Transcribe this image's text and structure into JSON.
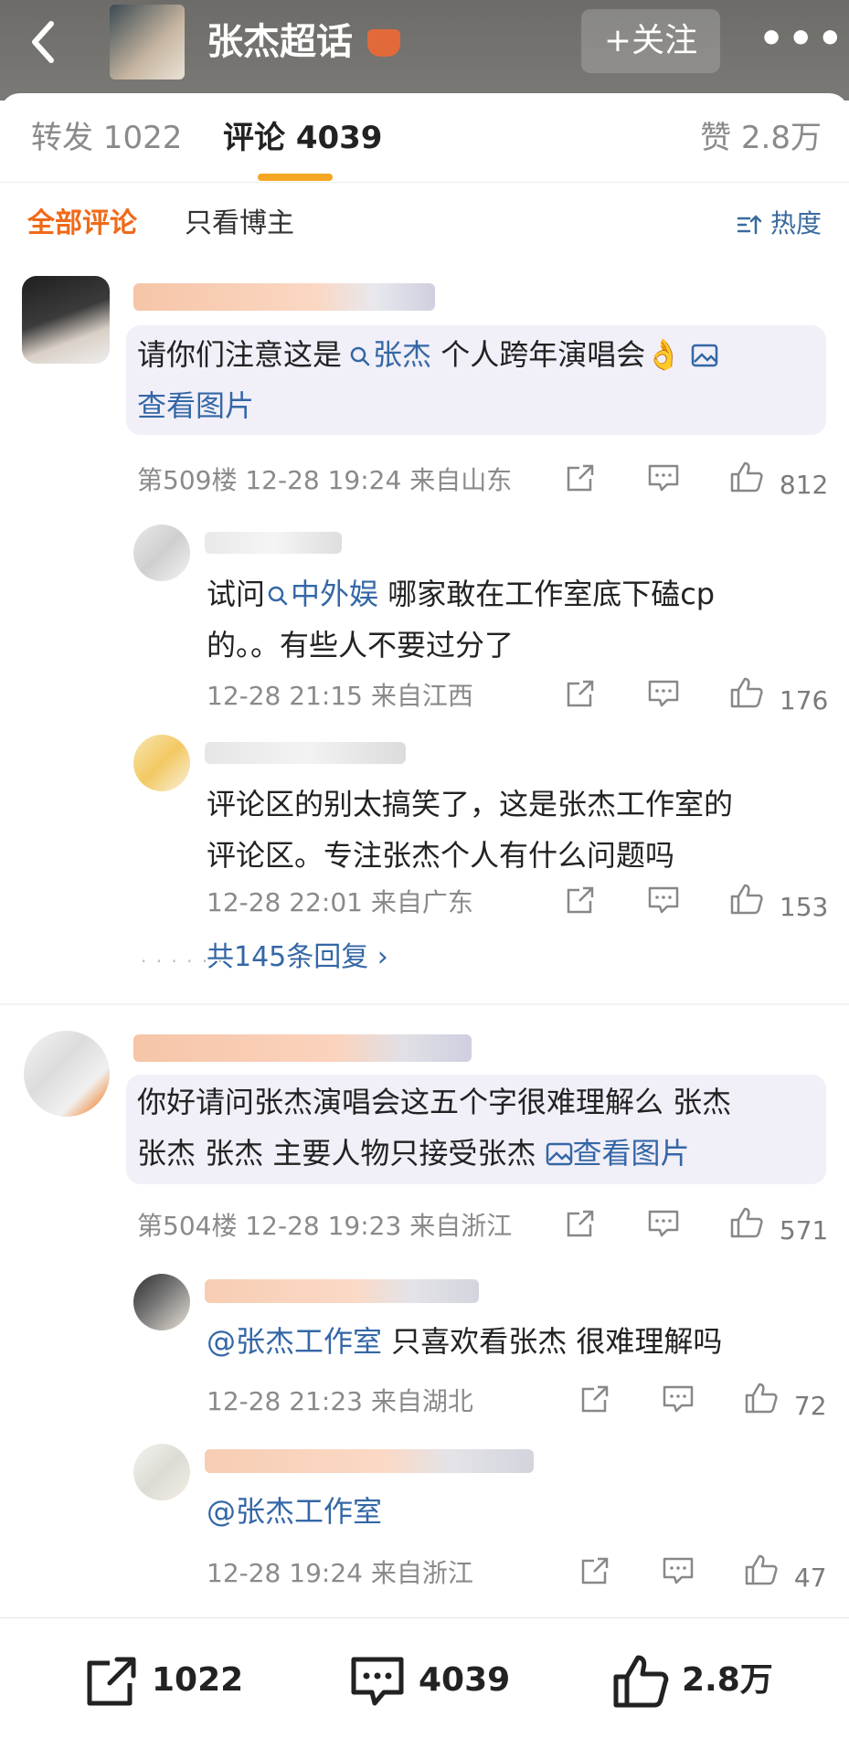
{
  "header": {
    "title": "张杰超话",
    "follow_label": "+关注",
    "more_label": "•••"
  },
  "tabs": [
    {
      "label": "转发 1022"
    },
    {
      "label": "评论 4039"
    },
    {
      "label": "赞 2.8万"
    }
  ],
  "filters": {
    "all": "全部评论",
    "owner_only": "只看博主",
    "sort": "热度"
  },
  "comments": [
    {
      "text_pre": "请你们注意这是",
      "mention": "张杰",
      "text_post": "个人跨年演唱会👌",
      "image_link": "查看图片",
      "floor": "第509楼",
      "time": "12-28 19:24",
      "location": "来自山东",
      "likes": "812",
      "replies": [
        {
          "text_pre": "试问",
          "mention": "中外娱",
          "text_post": "哪家敢在工作室底下磕cp",
          "text_line2": "的。。有些人不要过分了",
          "time": "12-28 21:15",
          "location": "来自江西",
          "likes": "176"
        },
        {
          "text_line1": "评论区的别太搞笑了，这是张杰工作室的",
          "text_line2": "评论区。专注张杰个人有什么问题吗",
          "time": "12-28 22:01",
          "location": "来自广东",
          "likes": "153"
        }
      ],
      "reply_count": "共145条回复 ›"
    },
    {
      "text_line1": "你好请问张杰演唱会这五个字很难理解么 张杰",
      "text_line2_pre": "张杰 张杰 主要人物只接受张杰",
      "image_link": "查看图片",
      "floor": "第504楼",
      "time": "12-28 19:23",
      "location": "来自浙江",
      "likes": "571",
      "replies": [
        {
          "mention": "@张杰工作室",
          "text_post": "只喜欢看张杰 很难理解吗",
          "time": "12-28 21:23",
          "location": "来自湖北",
          "likes": "72"
        },
        {
          "mention": "@张杰工作室",
          "time": "12-28 19:24",
          "location": "来自浙江",
          "likes": "47"
        }
      ]
    }
  ],
  "bottom_bar": {
    "repost": "1022",
    "comment": "4039",
    "like": "2.8万"
  }
}
